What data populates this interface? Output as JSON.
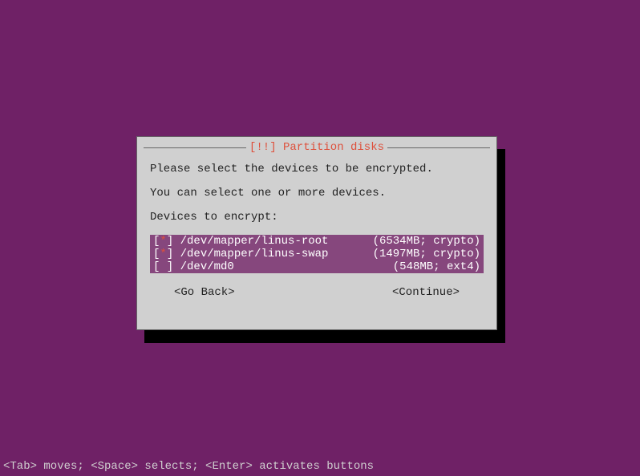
{
  "dialog": {
    "title": "[!!] Partition disks",
    "prompt1": "Please select the devices to be encrypted.",
    "prompt2": "You can select one or more devices.",
    "prompt3": "Devices to encrypt:",
    "devices": [
      {
        "checked": true,
        "highlighted": true,
        "path": "/dev/mapper/linus-root",
        "info": "(6534MB; crypto)"
      },
      {
        "checked": true,
        "highlighted": true,
        "selected_cursor": true,
        "path": "/dev/mapper/linus-swap",
        "info": "(1497MB; crypto)"
      },
      {
        "checked": false,
        "highlighted": true,
        "path": "/dev/md0",
        "info": "(548MB; ext4)"
      }
    ],
    "buttons": {
      "back": "<Go Back>",
      "continue": "<Continue>"
    }
  },
  "footer": "<Tab> moves; <Space> selects; <Enter> activates buttons"
}
